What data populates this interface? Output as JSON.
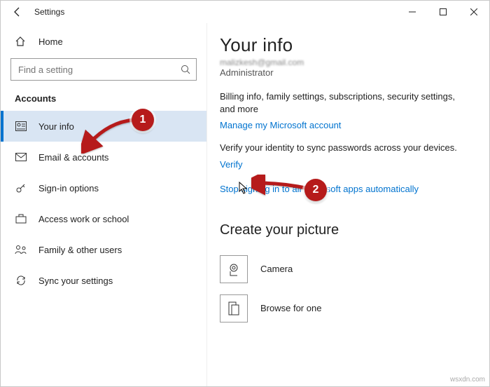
{
  "window": {
    "title": "Settings"
  },
  "sidebar": {
    "home": "Home",
    "search_placeholder": "Find a setting",
    "section": "Accounts",
    "items": [
      {
        "label": "Your info"
      },
      {
        "label": "Email & accounts"
      },
      {
        "label": "Sign-in options"
      },
      {
        "label": "Access work or school"
      },
      {
        "label": "Family & other users"
      },
      {
        "label": "Sync your settings"
      }
    ]
  },
  "content": {
    "heading": "Your info",
    "email": "malizkesh@gmail.com",
    "role": "Administrator",
    "billing_desc": "Billing info, family settings, subscriptions, security settings, and more",
    "manage_link": "Manage my Microsoft account",
    "verify_desc": "Verify your identity to sync passwords across your devices.",
    "verify_link": "Verify",
    "stop_link": "Stop signing in to all Microsoft apps automatically",
    "picture_heading": "Create your picture",
    "camera": "Camera",
    "browse": "Browse for one"
  },
  "callouts": {
    "step1": "1",
    "step2": "2"
  },
  "watermark": "wsxdn.com"
}
